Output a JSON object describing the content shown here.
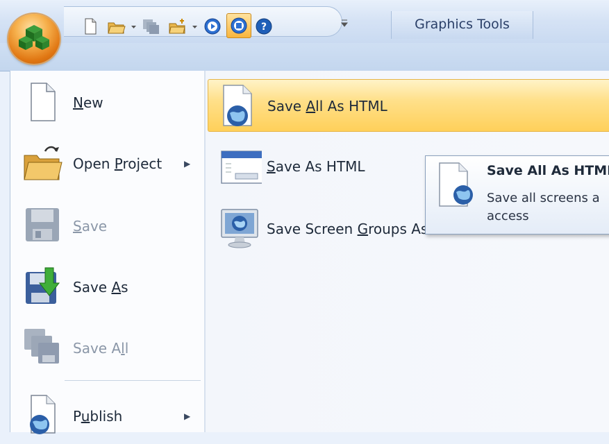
{
  "contextual_tab": "Graphics Tools",
  "left_menu": {
    "items": [
      {
        "id": "new",
        "pre": "",
        "acc": "N",
        "post": "ew",
        "disabled": false,
        "submenu": false
      },
      {
        "id": "open-project",
        "pre": "Open ",
        "acc": "P",
        "post": "roject",
        "disabled": false,
        "submenu": true
      },
      {
        "id": "save",
        "pre": "",
        "acc": "S",
        "post": "ave",
        "disabled": true,
        "submenu": false
      },
      {
        "id": "save-as",
        "pre": "Save ",
        "acc": "A",
        "post": "s",
        "disabled": false,
        "submenu": false
      },
      {
        "id": "save-all",
        "pre": "Save A",
        "acc": "l",
        "post": "l",
        "disabled": true,
        "submenu": false
      },
      {
        "id": "publish",
        "pre": "P",
        "acc": "u",
        "post": "blish",
        "disabled": false,
        "submenu": true
      }
    ]
  },
  "right_menu": {
    "items": [
      {
        "id": "save-all-html",
        "pre": "Save ",
        "acc": "A",
        "post": "ll As HTML",
        "highlighted": true
      },
      {
        "id": "save-as-html",
        "pre": "",
        "acc": "S",
        "post": "ave As HTML",
        "highlighted": false
      },
      {
        "id": "save-screen-groups",
        "pre": "Save Screen ",
        "acc": "G",
        "post": "roups As HTML",
        "highlighted": false
      }
    ]
  },
  "tooltip": {
    "title": "Save All As HTML",
    "description": "Save all screens a access"
  },
  "colors": {
    "highlight": "#ffd86e",
    "orb": "#e88a1e",
    "ribbon": "#c9daf1"
  }
}
